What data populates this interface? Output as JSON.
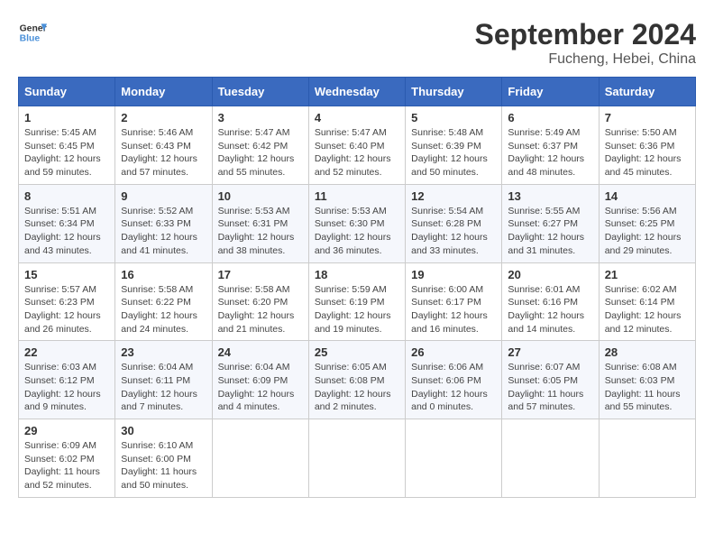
{
  "header": {
    "logo_line1": "General",
    "logo_line2": "Blue",
    "month": "September 2024",
    "location": "Fucheng, Hebei, China"
  },
  "days_of_week": [
    "Sunday",
    "Monday",
    "Tuesday",
    "Wednesday",
    "Thursday",
    "Friday",
    "Saturday"
  ],
  "weeks": [
    [
      {
        "day": "1",
        "info": "Sunrise: 5:45 AM\nSunset: 6:45 PM\nDaylight: 12 hours\nand 59 minutes."
      },
      {
        "day": "2",
        "info": "Sunrise: 5:46 AM\nSunset: 6:43 PM\nDaylight: 12 hours\nand 57 minutes."
      },
      {
        "day": "3",
        "info": "Sunrise: 5:47 AM\nSunset: 6:42 PM\nDaylight: 12 hours\nand 55 minutes."
      },
      {
        "day": "4",
        "info": "Sunrise: 5:47 AM\nSunset: 6:40 PM\nDaylight: 12 hours\nand 52 minutes."
      },
      {
        "day": "5",
        "info": "Sunrise: 5:48 AM\nSunset: 6:39 PM\nDaylight: 12 hours\nand 50 minutes."
      },
      {
        "day": "6",
        "info": "Sunrise: 5:49 AM\nSunset: 6:37 PM\nDaylight: 12 hours\nand 48 minutes."
      },
      {
        "day": "7",
        "info": "Sunrise: 5:50 AM\nSunset: 6:36 PM\nDaylight: 12 hours\nand 45 minutes."
      }
    ],
    [
      {
        "day": "8",
        "info": "Sunrise: 5:51 AM\nSunset: 6:34 PM\nDaylight: 12 hours\nand 43 minutes."
      },
      {
        "day": "9",
        "info": "Sunrise: 5:52 AM\nSunset: 6:33 PM\nDaylight: 12 hours\nand 41 minutes."
      },
      {
        "day": "10",
        "info": "Sunrise: 5:53 AM\nSunset: 6:31 PM\nDaylight: 12 hours\nand 38 minutes."
      },
      {
        "day": "11",
        "info": "Sunrise: 5:53 AM\nSunset: 6:30 PM\nDaylight: 12 hours\nand 36 minutes."
      },
      {
        "day": "12",
        "info": "Sunrise: 5:54 AM\nSunset: 6:28 PM\nDaylight: 12 hours\nand 33 minutes."
      },
      {
        "day": "13",
        "info": "Sunrise: 5:55 AM\nSunset: 6:27 PM\nDaylight: 12 hours\nand 31 minutes."
      },
      {
        "day": "14",
        "info": "Sunrise: 5:56 AM\nSunset: 6:25 PM\nDaylight: 12 hours\nand 29 minutes."
      }
    ],
    [
      {
        "day": "15",
        "info": "Sunrise: 5:57 AM\nSunset: 6:23 PM\nDaylight: 12 hours\nand 26 minutes."
      },
      {
        "day": "16",
        "info": "Sunrise: 5:58 AM\nSunset: 6:22 PM\nDaylight: 12 hours\nand 24 minutes."
      },
      {
        "day": "17",
        "info": "Sunrise: 5:58 AM\nSunset: 6:20 PM\nDaylight: 12 hours\nand 21 minutes."
      },
      {
        "day": "18",
        "info": "Sunrise: 5:59 AM\nSunset: 6:19 PM\nDaylight: 12 hours\nand 19 minutes."
      },
      {
        "day": "19",
        "info": "Sunrise: 6:00 AM\nSunset: 6:17 PM\nDaylight: 12 hours\nand 16 minutes."
      },
      {
        "day": "20",
        "info": "Sunrise: 6:01 AM\nSunset: 6:16 PM\nDaylight: 12 hours\nand 14 minutes."
      },
      {
        "day": "21",
        "info": "Sunrise: 6:02 AM\nSunset: 6:14 PM\nDaylight: 12 hours\nand 12 minutes."
      }
    ],
    [
      {
        "day": "22",
        "info": "Sunrise: 6:03 AM\nSunset: 6:12 PM\nDaylight: 12 hours\nand 9 minutes."
      },
      {
        "day": "23",
        "info": "Sunrise: 6:04 AM\nSunset: 6:11 PM\nDaylight: 12 hours\nand 7 minutes."
      },
      {
        "day": "24",
        "info": "Sunrise: 6:04 AM\nSunset: 6:09 PM\nDaylight: 12 hours\nand 4 minutes."
      },
      {
        "day": "25",
        "info": "Sunrise: 6:05 AM\nSunset: 6:08 PM\nDaylight: 12 hours\nand 2 minutes."
      },
      {
        "day": "26",
        "info": "Sunrise: 6:06 AM\nSunset: 6:06 PM\nDaylight: 12 hours\nand 0 minutes."
      },
      {
        "day": "27",
        "info": "Sunrise: 6:07 AM\nSunset: 6:05 PM\nDaylight: 11 hours\nand 57 minutes."
      },
      {
        "day": "28",
        "info": "Sunrise: 6:08 AM\nSunset: 6:03 PM\nDaylight: 11 hours\nand 55 minutes."
      }
    ],
    [
      {
        "day": "29",
        "info": "Sunrise: 6:09 AM\nSunset: 6:02 PM\nDaylight: 11 hours\nand 52 minutes."
      },
      {
        "day": "30",
        "info": "Sunrise: 6:10 AM\nSunset: 6:00 PM\nDaylight: 11 hours\nand 50 minutes."
      },
      {
        "day": "",
        "info": ""
      },
      {
        "day": "",
        "info": ""
      },
      {
        "day": "",
        "info": ""
      },
      {
        "day": "",
        "info": ""
      },
      {
        "day": "",
        "info": ""
      }
    ]
  ]
}
